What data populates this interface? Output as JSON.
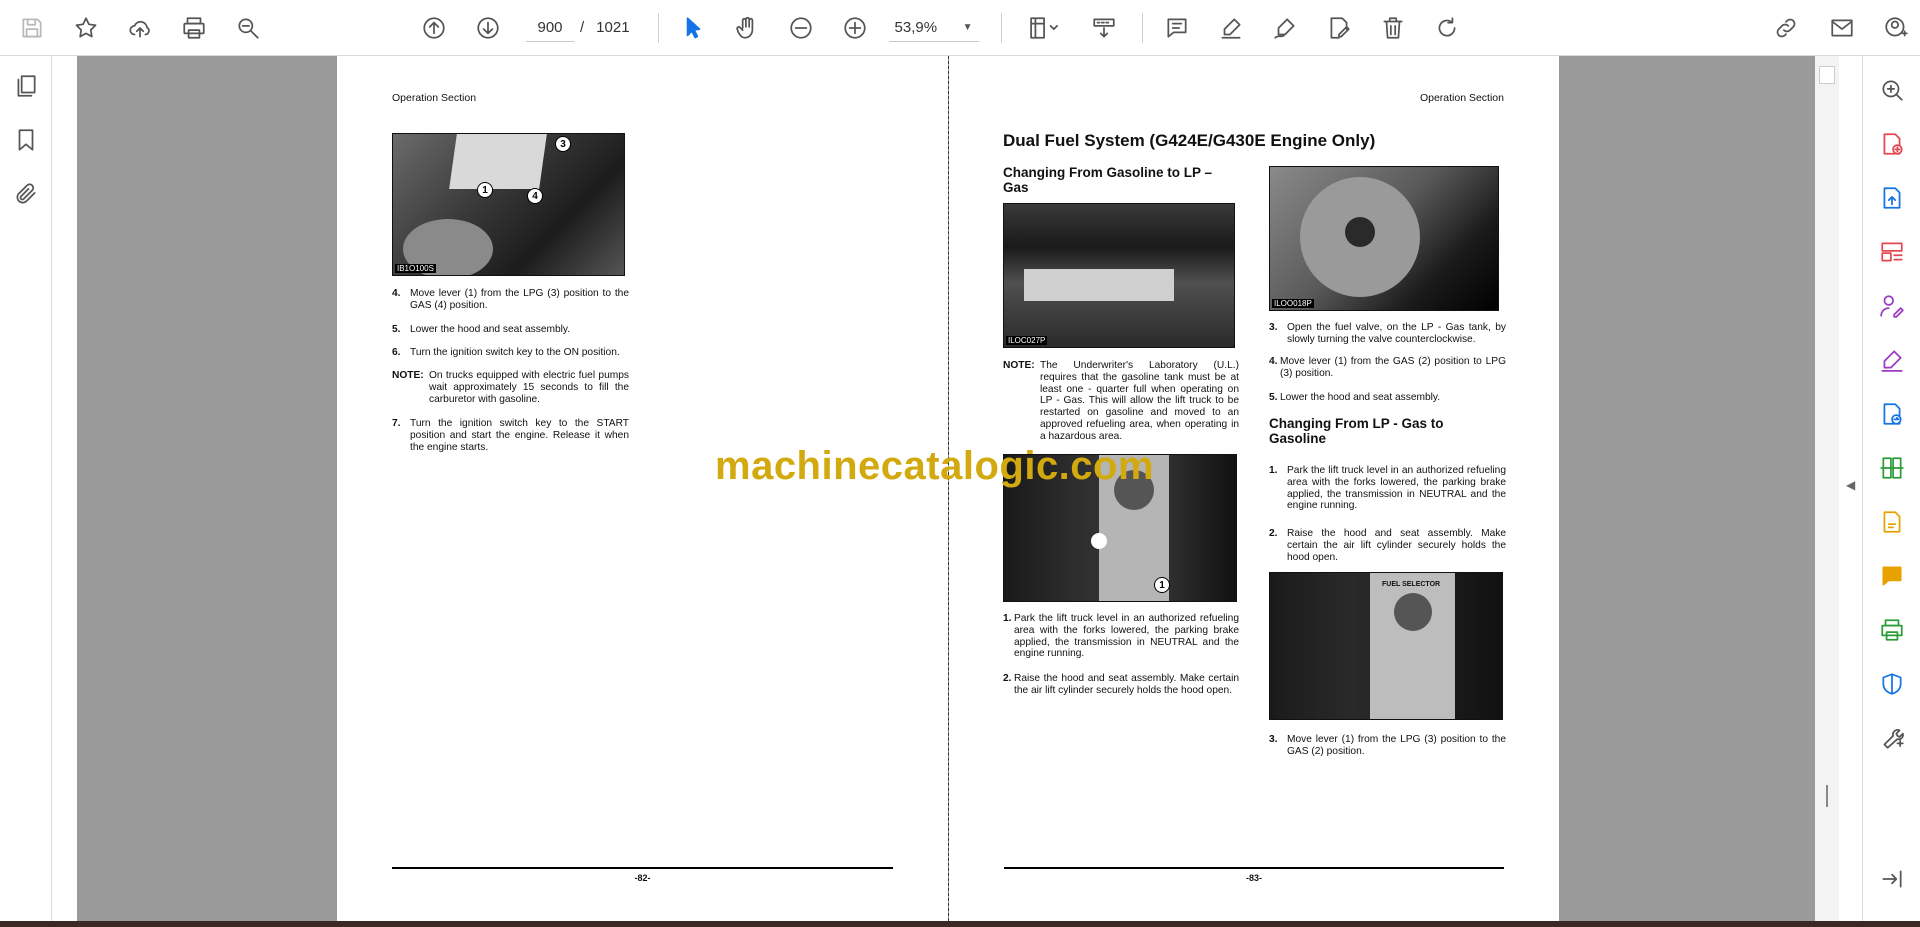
{
  "toolbar": {
    "page_current": "900",
    "page_separator": "/",
    "page_total": "1021",
    "zoom": "53,9%"
  },
  "left_page": {
    "running_head": "Operation Section",
    "photo_tag": "IB1O100S",
    "callouts": [
      "3",
      "1",
      "4"
    ],
    "steps": [
      {
        "num": "4.",
        "text": "Move lever (1) from the LPG (3) position to the GAS (4) position."
      },
      {
        "num": "5.",
        "text": "Lower the hood and seat assembly."
      },
      {
        "num": "6.",
        "text": "Turn the ignition switch key to the ON position."
      },
      {
        "num": "NOTE:",
        "text": "On trucks equipped with electric fuel pumps wait approximately 15 seconds to fill the carburetor with gasoline."
      },
      {
        "num": "7.",
        "text": "Turn the ignition switch key to the START position and start the engine. Release it when the engine starts."
      }
    ],
    "page_number": "-82-"
  },
  "right_page": {
    "running_head": "Operation Section",
    "title": "Dual Fuel System (G424E/G430E Engine Only)",
    "col1": {
      "heading": "Changing From Gasoline to LP – Gas",
      "photo1_tag": "ILOC027P",
      "note_label": "NOTE:",
      "note_text": "The Underwriter's Laboratory (U.L.) requires that the gasoline tank must be at least one - quarter full when operating on LP - Gas. This will allow the lift truck to be restarted on gasoline and moved to an approved refueling area, when operating in a hazardous area.",
      "photo2_callout": "1",
      "steps": [
        {
          "num": "1.",
          "text": "Park the lift truck level in an authorized refueling area with the forks lowered, the parking brake applied, the transmission in NEUTRAL and the engine running."
        },
        {
          "num": "2.",
          "text": "Raise the hood and seat assembly. Make certain the air lift cylinder securely holds the hood open."
        }
      ]
    },
    "col2": {
      "photo1_tag": "ILOO018P",
      "steps_a": [
        {
          "num": "3.",
          "text": "Open the fuel valve, on the LP - Gas tank, by slowly turning the valve counterclockwise."
        },
        {
          "num": "4.",
          "text": "Move lever (1) from the GAS (2) position to LPG (3) position."
        },
        {
          "num": "5.",
          "text": "Lower the hood and seat assembly."
        }
      ],
      "heading": "Changing From LP - Gas to Gasoline",
      "steps_b": [
        {
          "num": "1.",
          "text": "Park the lift truck level in an authorized refueling area with the forks lowered, the parking brake applied, the transmission in NEUTRAL and the engine running."
        },
        {
          "num": "2.",
          "text": "Raise the hood and seat assembly. Make certain the air lift cylinder securely holds the hood open."
        }
      ],
      "photo2_label": "FUEL SELECTOR",
      "steps_c": [
        {
          "num": "3.",
          "text": "Move lever (1) from the LPG (3) position to the GAS (2) position."
        }
      ]
    },
    "page_number": "-83-"
  },
  "watermark": "machinecatalogic.com",
  "colors": {
    "accent": "#1473e6",
    "watermark": "#d2a90f",
    "canvas": "#9a9a9a"
  }
}
